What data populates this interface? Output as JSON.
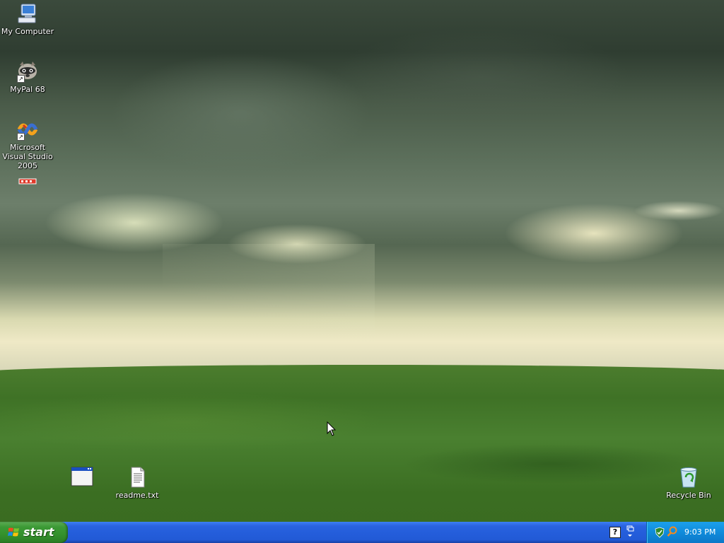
{
  "desktop": {
    "icons": [
      {
        "label": "My Computer"
      },
      {
        "label": "MyPal 68"
      },
      {
        "label": "Microsoft Visual Studio 2005"
      },
      {
        "label": ""
      },
      {
        "label": ""
      },
      {
        "label": "readme.txt"
      },
      {
        "label": "Recycle Bin"
      }
    ]
  },
  "taskbar": {
    "start_label": "start",
    "tray": {
      "clock": "9:03 PM",
      "icons": [
        "help-icon",
        "network-icon",
        "security-shield-icon",
        "search-icon"
      ]
    }
  },
  "colors": {
    "taskbar_blue": "#245edb",
    "start_green": "#3c9a35",
    "tray_blue": "#0f8bdb"
  }
}
